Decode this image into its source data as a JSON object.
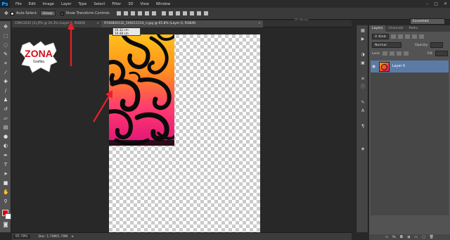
{
  "app": {
    "logo": "Ps"
  },
  "menu": [
    "File",
    "Edit",
    "Image",
    "Layer",
    "Type",
    "Select",
    "Filter",
    "3D",
    "View",
    "Window"
  ],
  "window_controls": [
    "–",
    "□",
    "✕"
  ],
  "options_bar": {
    "auto_select_label": "Auto-Select:",
    "auto_select_value": "Group",
    "show_transform_label": "Show Transform Controls",
    "mode_3d_label": "3D Mode:",
    "workspace": "Essentials"
  },
  "tabs": [
    {
      "label": "CIMG1635 (2).JPG @ 20.3% (Layer 1, RGB/8)"
    },
    {
      "label": "9740820132_549211514_n.jpg @ 65.8% (Layer 0, RGB/8)"
    }
  ],
  "ruler_tip": {
    "w": "10.32 cm",
    "h": "10.48 cm"
  },
  "watermark": {
    "text": "ZONA",
    "subtext": "Grafika"
  },
  "status": {
    "zoom": "65.78%",
    "doc": "Doc: 1.79M/1.79M"
  },
  "layers_panel": {
    "tabs": [
      "Layers",
      "Channels",
      "Paths"
    ],
    "filter_kind": "Kind",
    "blend_mode": "Normal",
    "opacity_label": "Opacity:",
    "lock_label": "Lock:",
    "fill_label": "Fill:",
    "layer_name": "Layer 0"
  },
  "colors": {
    "foreground": "#e00000",
    "background": "#ffffff",
    "arrow": "#e8202a",
    "selected_layer": "#5c7aa6"
  },
  "icons": {
    "toolbar": [
      "move-icon",
      "marquee-icon",
      "lasso-icon",
      "quick-select-icon",
      "crop-icon",
      "eyedropper-icon",
      "healing-icon",
      "brush-icon",
      "clone-stamp-icon",
      "history-brush-icon",
      "eraser-icon",
      "gradient-icon",
      "blur-icon",
      "dodge-icon",
      "pen-icon",
      "type-icon",
      "path-select-icon",
      "rectangle-icon",
      "hand-icon",
      "zoom-icon"
    ]
  }
}
